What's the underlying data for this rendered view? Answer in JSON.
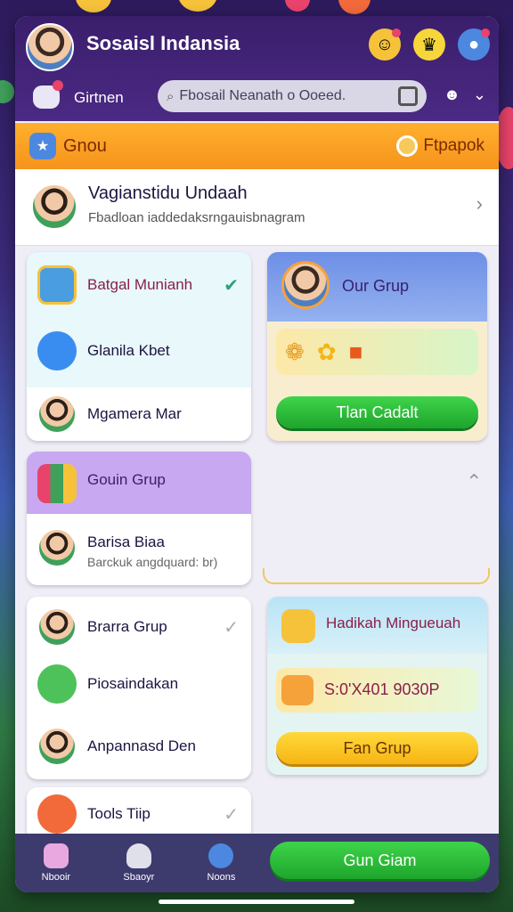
{
  "header": {
    "title": "Sosaisl Indansia",
    "icons": [
      "smiley-icon",
      "trophy-icon",
      "chat-bubble-icon"
    ]
  },
  "subheader": {
    "label": "Girtnen",
    "search_text": "Fbosail Neanath o Ooeed.",
    "icons": [
      "search-icon",
      "qr-icon",
      "face-icon",
      "chevron-down-icon"
    ]
  },
  "group_bar": {
    "title": "Gnou",
    "right_label": "Ftpapok"
  },
  "profile": {
    "name": "Vagianstidu Undaah",
    "subtitle": "Fbadloan iaddedaksrngauisbnagram"
  },
  "left_cards": {
    "card1": {
      "header": "Batgal Munianh",
      "items": [
        "Glanila Kbet",
        "Mgamera Mar"
      ]
    },
    "card2": {
      "header": "Gouin Grup",
      "item_name": "Barisa Biaa",
      "item_sub": "Barckuk angdquard: br)"
    },
    "card3": {
      "items": [
        "Brarra Grup",
        "Piosaindakan",
        "Anpannasd Den"
      ]
    },
    "card4": {
      "items": [
        "Tools Tiip"
      ]
    }
  },
  "right_cards": {
    "our_group": {
      "title": "Our Grup",
      "button": "Tlan Cadalt"
    },
    "hadikah": {
      "title": "Hadikah Mingueuah",
      "code": "S:0'X401 9030P",
      "button": "Fan Grup"
    }
  },
  "bottom_nav": {
    "items": [
      "Nbooir",
      "Sbaoyr",
      "Noons"
    ],
    "cta": "Gun Giam"
  },
  "colors": {
    "accent_orange": "#f6931c",
    "header_purple": "#3a1e6b",
    "button_green": "#1ea52c",
    "button_yellow": "#f6b514"
  }
}
